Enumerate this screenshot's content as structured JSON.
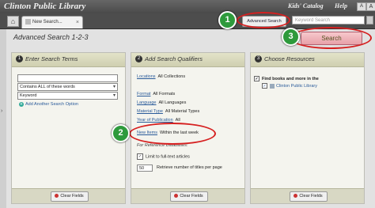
{
  "header": {
    "brand": "Clinton Public Library",
    "nav": [
      "Kids' Catalog",
      "Help"
    ],
    "font_size_small": "A",
    "font_size_large": "A"
  },
  "tabs": {
    "home_icon": "home-icon",
    "active_tab": "New Search..."
  },
  "toolbar": {
    "advanced_search_label": "Advanced Search",
    "keyword_placeholder": "Keyword Search",
    "search_button_label": "Search"
  },
  "page": {
    "title": "Advanced Search 1-2-3"
  },
  "panel1": {
    "number": "1",
    "title": "Enter Search Terms",
    "search_value": "",
    "match_select": "Contains ALL of these words",
    "field_select": "Keyword",
    "add_option": "Add Another Search Option",
    "clear_label": "Clear Fields"
  },
  "panel2": {
    "number": "2",
    "title": "Add Search Qualifiers",
    "qualifiers": [
      {
        "label": "Locations",
        "value": "All Collections"
      },
      {
        "label": "Format",
        "value": "All Formats"
      },
      {
        "label": "Language",
        "value": "All Languages"
      },
      {
        "label": "Material Type",
        "value": "All Material Types"
      },
      {
        "label": "Year of Publication",
        "value": "All"
      },
      {
        "label": "New Items",
        "value": "Within the last week"
      }
    ],
    "reference_note": "For Reference Databases:",
    "limit_label": "Limit to full-text articles",
    "retrieve_count": "50",
    "retrieve_label": "Retrieve number of titles per page",
    "clear_label": "Clear Fields"
  },
  "panel3": {
    "number": "3",
    "title": "Choose Resources",
    "group_label": "Find books and more in the",
    "resource_label": "Clinton Public Library",
    "clear_label": "Clear Fields"
  },
  "callouts": [
    "1",
    "2",
    "3"
  ],
  "colors": {
    "callout_green": "#2e9a3c",
    "highlight_red": "#d62020",
    "link_blue": "#2a5b9a"
  }
}
